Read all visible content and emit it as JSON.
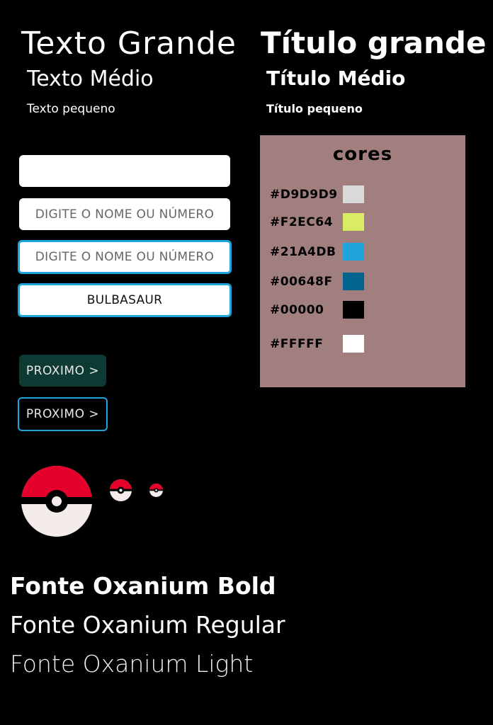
{
  "typography": {
    "text_large": "Texto Grande",
    "text_medium": "Texto Médio",
    "text_small": "Texto pequeno",
    "title_large": "Título grande",
    "title_medium": "Título Médio",
    "title_small": "Título pequeno"
  },
  "inputs": {
    "empty_value": "",
    "placeholder": "DIGITE O NOME OU NÚMERO",
    "focused_placeholder": "DIGITE O NOME OU NÚMERO",
    "filled_value": "BULBASAUR"
  },
  "buttons": {
    "next_filled": "PROXIMO >",
    "next_outline": "PROXIMO >"
  },
  "colors_panel": {
    "title": "cores",
    "swatches": [
      {
        "code": "#D9D9D9",
        "color": "#D9D9D9"
      },
      {
        "code": "#F2EC64",
        "color": "#D9EC64"
      },
      {
        "code": "#21A4DB",
        "color": "#21A4DB"
      },
      {
        "code": "#00648F",
        "color": "#00648F"
      },
      {
        "code": "#00000",
        "color": "#000000"
      },
      {
        "code": "#FFFFF",
        "color": "#FFFFFF"
      }
    ]
  },
  "icons": {
    "pokeball_large": "pokeball-icon",
    "pokeball_medium": "pokeball-icon",
    "pokeball_small": "pokeball-icon",
    "pokeball_red": "#E4002B",
    "pokeball_white": "#F4ECEA"
  },
  "fonts": {
    "bold": "Fonte Oxanium Bold",
    "regular": "Fonte Oxanium Regular",
    "light": "Fonte Oxanium Light"
  }
}
